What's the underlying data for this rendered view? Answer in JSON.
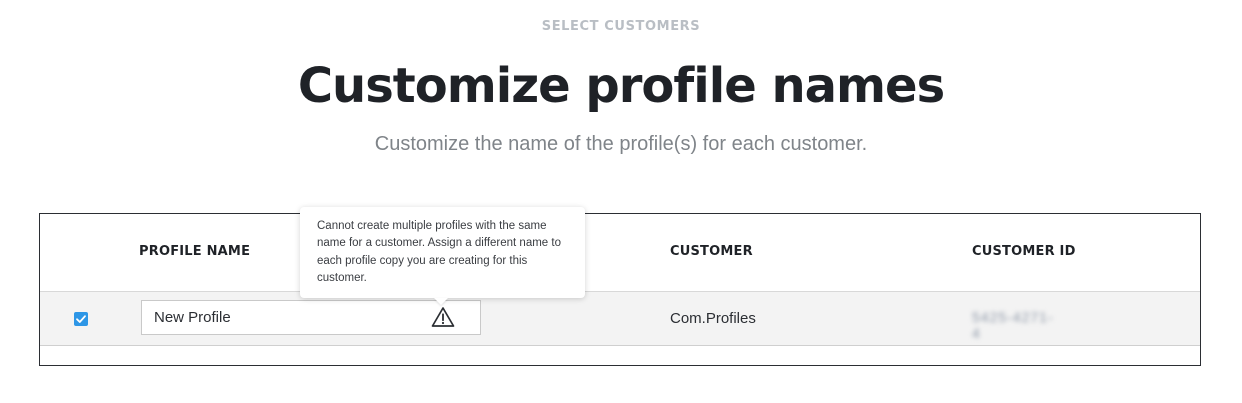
{
  "header": {
    "step_label": "SELECT CUSTOMERS",
    "title": "Customize profile names",
    "subtitle": "Customize the name of the profile(s) for each customer."
  },
  "table": {
    "columns": [
      "PROFILE NAME",
      "CUSTOMER",
      "CUSTOMER ID"
    ],
    "rows": [
      {
        "selected": true,
        "profile_name": "New Profile",
        "customer": "Com.Profiles",
        "customer_id": "5425-4271-4"
      }
    ]
  },
  "tooltip": {
    "text": "Cannot create multiple profiles with the same name for a customer. Assign a different name to each profile copy you are creating for this customer."
  },
  "colors": {
    "checkbox": "#2d96e6",
    "title": "#1f2227",
    "step_label": "#b9bec4",
    "subtitle": "#7f8489"
  },
  "icons": {
    "checkbox": "check-icon",
    "warning": "warning-triangle-icon"
  }
}
